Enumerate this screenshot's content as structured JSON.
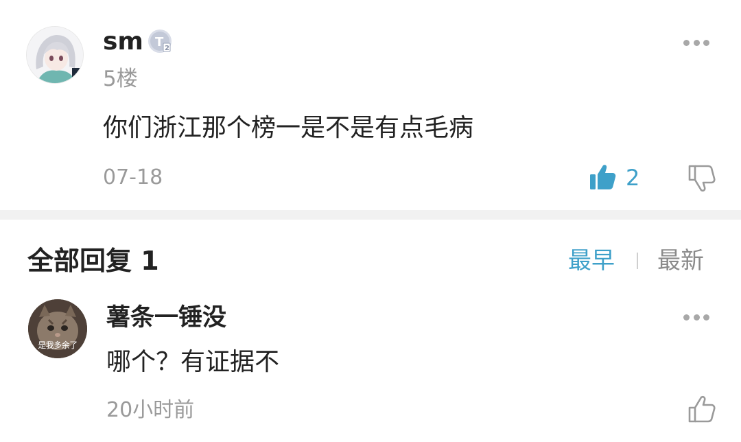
{
  "post": {
    "username": "sm",
    "level_badge": "T2",
    "floor": "5楼",
    "content": "你们浙江那个榜一是不是有点毛病",
    "date": "07-18",
    "like_count": "2"
  },
  "replies_header": {
    "title": "全部回复 1",
    "sort_early": "最早",
    "sort_new": "最新"
  },
  "reply": {
    "avatar_caption": "是我多余了",
    "username": "薯条一锤没",
    "content": "哪个？有证据不",
    "time": "20小时前"
  },
  "colors": {
    "accent": "#3ea0c9",
    "muted_text": "#9a9a9a",
    "divider": "#f1f1f1"
  },
  "icons": [
    "more-icon",
    "thumbs-up-icon",
    "thumbs-down-icon",
    "level-badge-icon"
  ]
}
